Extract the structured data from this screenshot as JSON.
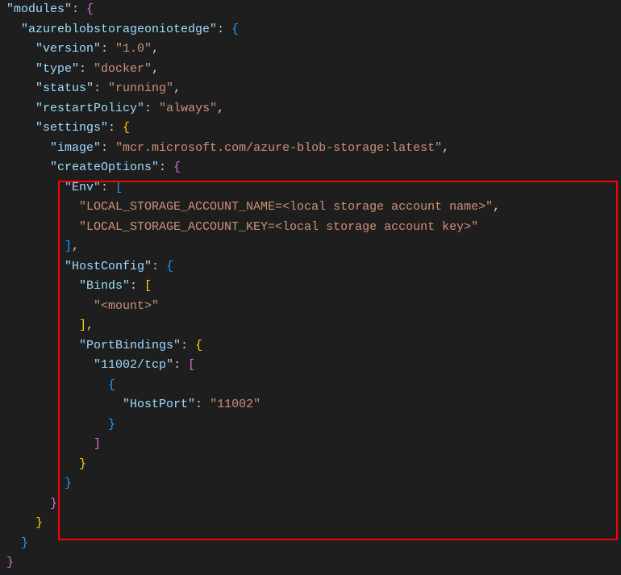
{
  "code": {
    "l1_key": "\"modules\"",
    "l2_key": "\"azureblobstorageoniotedge\"",
    "l3_key": "\"version\"",
    "l3_val": "\"1.0\"",
    "l4_key": "\"type\"",
    "l4_val": "\"docker\"",
    "l5_key": "\"status\"",
    "l5_val": "\"running\"",
    "l6_key": "\"restartPolicy\"",
    "l6_val": "\"always\"",
    "l7_key": "\"settings\"",
    "l8_key": "\"image\"",
    "l8_val": "\"mcr.microsoft.com/azure-blob-storage:latest\"",
    "l9_key": "\"createOptions\"",
    "l10_key": "\"Env\"",
    "l11_val": "\"LOCAL_STORAGE_ACCOUNT_NAME=<local storage account name>\"",
    "l12_val": "\"LOCAL_STORAGE_ACCOUNT_KEY=<local storage account key>\"",
    "l14_key": "\"HostConfig\"",
    "l15_key": "\"Binds\"",
    "l16_val": "\"<mount>\"",
    "l18_key": "\"PortBindings\"",
    "l19_key": "\"11002/tcp\"",
    "l21_key": "\"HostPort\"",
    "l21_val": "\"11002\""
  },
  "colors": {
    "background": "#1e1e1e",
    "key": "#9cdcfe",
    "string": "#ce9178",
    "brace_yellow": "#ffd700",
    "brace_pink": "#da70d6",
    "brace_blue": "#179fff",
    "highlight": "#ff0000",
    "guide": "#404040"
  }
}
